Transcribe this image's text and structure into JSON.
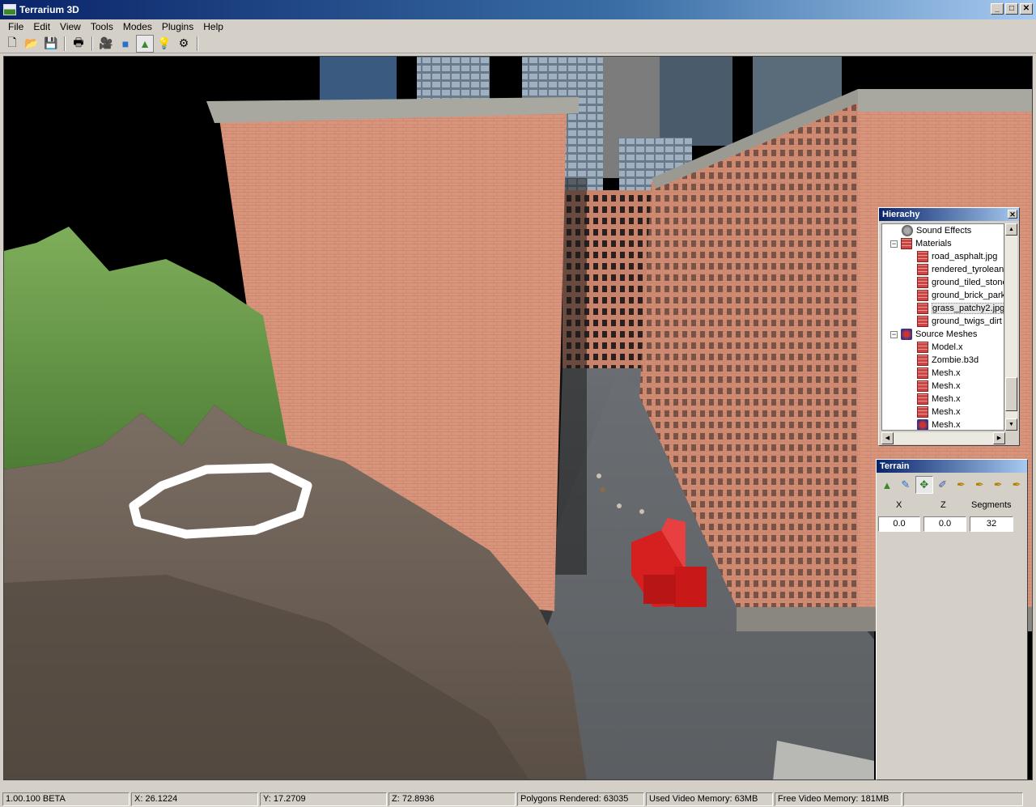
{
  "window": {
    "title": "Terrarium 3D"
  },
  "menu": [
    "File",
    "Edit",
    "View",
    "Tools",
    "Modes",
    "Plugins",
    "Help"
  ],
  "toolbar": [
    {
      "name": "new-file-icon",
      "glyph": "🗋"
    },
    {
      "name": "open-folder-icon",
      "glyph": "📂"
    },
    {
      "name": "save-icon",
      "glyph": "💾"
    },
    {
      "name": "print-icon",
      "glyph": "🖶"
    },
    {
      "name": "camera-icon",
      "glyph": "🎥"
    },
    {
      "name": "cube-icon",
      "glyph": "■"
    },
    {
      "name": "terrain-icon",
      "glyph": "▲"
    },
    {
      "name": "light-bulb-icon",
      "glyph": "💡"
    },
    {
      "name": "sound-icon",
      "glyph": "⚙"
    }
  ],
  "hierarchy": {
    "title": "Hierachy",
    "items": [
      {
        "label": "Sound Effects",
        "level": 1,
        "icon": "sound-icon"
      },
      {
        "label": "Materials",
        "level": 0,
        "icon": "material-folder-icon",
        "expander": "−"
      },
      {
        "label": "road_asphalt.jpg",
        "level": 2,
        "icon": "texture-icon"
      },
      {
        "label": "rendered_tyrolean",
        "level": 2,
        "icon": "texture-icon"
      },
      {
        "label": "ground_tiled_stone",
        "level": 2,
        "icon": "texture-icon"
      },
      {
        "label": "ground_brick_park",
        "level": 2,
        "icon": "texture-icon"
      },
      {
        "label": "grass_patchy2.jpg",
        "level": 2,
        "icon": "texture-icon",
        "selected": true
      },
      {
        "label": "ground_twigs_dirt",
        "level": 2,
        "icon": "texture-icon"
      },
      {
        "label": "Source Meshes",
        "level": 0,
        "icon": "mesh-folder-icon",
        "expander": "−"
      },
      {
        "label": "Model.x",
        "level": 2,
        "icon": "texture-icon"
      },
      {
        "label": "Zombie.b3d",
        "level": 2,
        "icon": "texture-icon"
      },
      {
        "label": "Mesh.x",
        "level": 2,
        "icon": "texture-icon"
      },
      {
        "label": "Mesh.x",
        "level": 2,
        "icon": "texture-icon"
      },
      {
        "label": "Mesh.x",
        "level": 2,
        "icon": "texture-icon"
      },
      {
        "label": "Mesh.x",
        "level": 2,
        "icon": "texture-icon"
      },
      {
        "label": "Mesh.x",
        "level": 2,
        "icon": "mesh-icon"
      }
    ]
  },
  "terrain": {
    "title": "Terrain",
    "tools": [
      "terrain-icon",
      "paint-icon",
      "move-icon",
      "brush-icon",
      "eyedropper-icon",
      "eyedropper-icon",
      "eyedropper-icon",
      "eyedropper-icon"
    ],
    "labels": {
      "x": "X",
      "z": "Z",
      "segments": "Segments"
    },
    "values": {
      "x": "0.0",
      "z": "0.0",
      "segments": "32"
    }
  },
  "status": [
    "1.00.100 BETA",
    "X: 26.1224",
    "Y: 17.2709",
    "Z: 72.8936",
    "Polygons Rendered: 63035",
    "Used Video Memory: 63MB",
    "Free Video Memory: 181MB",
    ""
  ],
  "colors": {
    "titlebar": "#0a246a",
    "chrome": "#d4d0c8",
    "brick": "#d9957c",
    "grass": "#6a9a4a",
    "dirt": "#6e6258",
    "containers": "#d62020"
  }
}
